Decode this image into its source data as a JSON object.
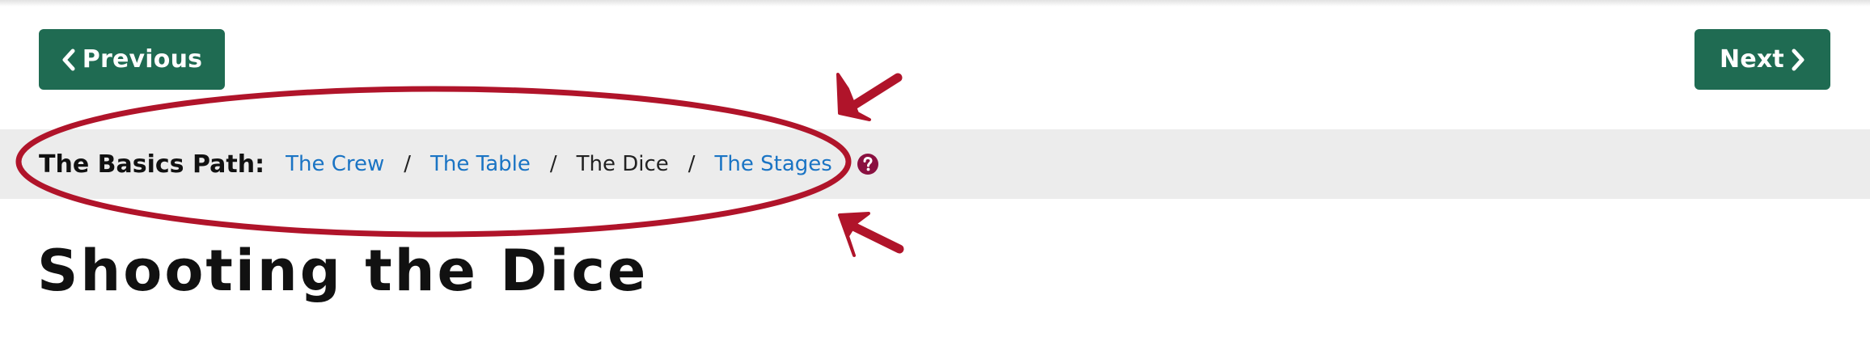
{
  "navigation": {
    "previous_label": "Previous",
    "next_label": "Next",
    "previous_icon": "chevron-left-icon",
    "next_icon": "chevron-right-icon",
    "button_color": "#1f6b52"
  },
  "breadcrumb": {
    "label": "The Basics Path:",
    "separator": "/",
    "items": [
      {
        "label": "The Crew",
        "is_link": true
      },
      {
        "label": "The Table",
        "is_link": true
      },
      {
        "label": "The Dice",
        "is_link": false
      },
      {
        "label": "The Stages",
        "is_link": true
      }
    ],
    "help_icon": "question-circle-icon",
    "link_color": "#1a74c4",
    "band_color": "#ececec"
  },
  "annotations": {
    "color": "#b0142a",
    "shapes": [
      "ellipse-highlight",
      "arrow-upper",
      "arrow-lower"
    ]
  },
  "page": {
    "title": "Shooting the Dice"
  }
}
